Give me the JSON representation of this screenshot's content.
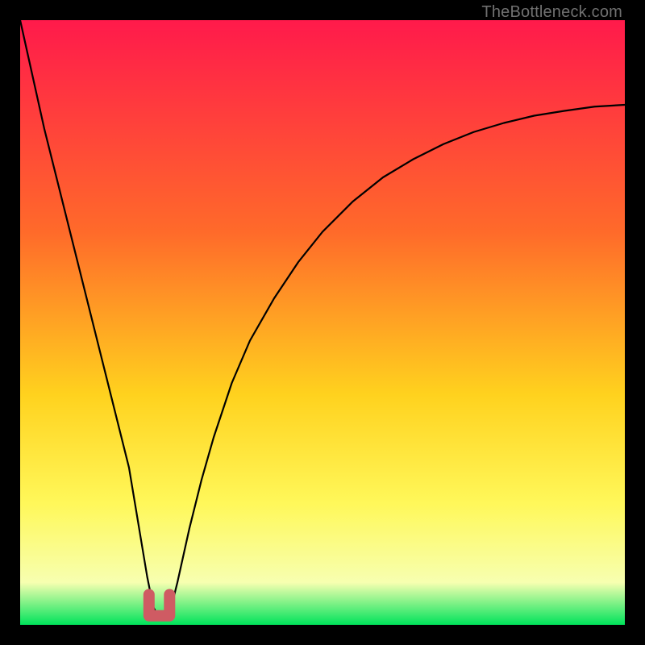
{
  "watermark": "TheBottleneck.com",
  "colors": {
    "frame": "#000000",
    "grad_top": "#ff1a4b",
    "grad_mid1": "#ff6a2a",
    "grad_mid2": "#ffd21e",
    "grad_mid3": "#fff85a",
    "grad_low": "#f7ffb0",
    "grad_bottom": "#00e35b",
    "curve": "#000000",
    "marker": "#cf5b63"
  },
  "chart_data": {
    "type": "line",
    "title": "",
    "xlabel": "",
    "ylabel": "",
    "xlim": [
      0,
      100
    ],
    "ylim": [
      0,
      100
    ],
    "series": [
      {
        "name": "bottleneck-curve",
        "x": [
          0,
          2,
          4,
          6,
          8,
          10,
          12,
          14,
          16,
          18,
          20,
          21,
          22,
          23,
          24,
          25,
          26,
          28,
          30,
          32,
          35,
          38,
          42,
          46,
          50,
          55,
          60,
          65,
          70,
          75,
          80,
          85,
          90,
          95,
          100
        ],
        "y": [
          100,
          91,
          82,
          74,
          66,
          58,
          50,
          42,
          34,
          26,
          14,
          8,
          3,
          1,
          1,
          3,
          7,
          16,
          24,
          31,
          40,
          47,
          54,
          60,
          65,
          70,
          74,
          77,
          79.5,
          81.5,
          83,
          84.2,
          85,
          85.7,
          86
        ]
      }
    ],
    "marker": {
      "name": "optimal-range",
      "x": [
        21.3,
        24.7
      ],
      "y_level": 1.5,
      "note": "U-shaped indicator at curve minimum"
    },
    "gradient_stops": [
      {
        "pct": 0,
        "meaning": "worst",
        "color": "#ff1a4b"
      },
      {
        "pct": 35,
        "meaning": "bad",
        "color": "#ff6a2a"
      },
      {
        "pct": 62,
        "meaning": "mid",
        "color": "#ffd21e"
      },
      {
        "pct": 80,
        "meaning": "ok",
        "color": "#fff85a"
      },
      {
        "pct": 93,
        "meaning": "good",
        "color": "#f7ffb0"
      },
      {
        "pct": 100,
        "meaning": "best",
        "color": "#00e35b"
      }
    ]
  }
}
